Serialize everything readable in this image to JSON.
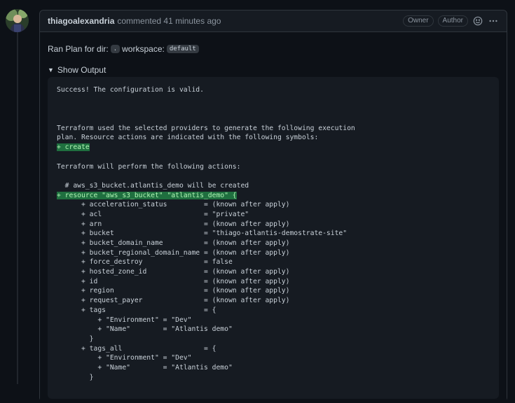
{
  "comment": {
    "author": "thiagoalexandria",
    "action": "commented 41 minutes ago",
    "badges": [
      "Owner",
      "Author"
    ],
    "emoji_icon": "smiley-icon",
    "menu_icon": "kebab-horizontal-icon",
    "ran_plan_prefix": "Ran Plan for dir:",
    "dir_value": ".",
    "workspace_label": "workspace:",
    "workspace_value": "default",
    "details_label": "Show Output"
  },
  "output_lines": [
    {
      "text": "Success! The configuration is valid.",
      "added": false
    },
    {
      "text": "",
      "added": false
    },
    {
      "text": "",
      "added": false
    },
    {
      "text": "",
      "added": false
    },
    {
      "text": "Terraform used the selected providers to generate the following execution",
      "added": false
    },
    {
      "text": "plan. Resource actions are indicated with the following symbols:",
      "added": false
    },
    {
      "text": "+ create",
      "added": true
    },
    {
      "text": "",
      "added": false
    },
    {
      "text": "Terraform will perform the following actions:",
      "added": false
    },
    {
      "text": "",
      "added": false
    },
    {
      "text": "  # aws_s3_bucket.atlantis_demo will be created",
      "added": false
    },
    {
      "text": "+ resource \"aws_s3_bucket\" \"atlantis_demo\" {",
      "added": true
    },
    {
      "text": "      + acceleration_status         = (known after apply)",
      "added": false
    },
    {
      "text": "      + acl                         = \"private\"",
      "added": false
    },
    {
      "text": "      + arn                         = (known after apply)",
      "added": false
    },
    {
      "text": "      + bucket                      = \"thiago-atlantis-demostrate-site\"",
      "added": false
    },
    {
      "text": "      + bucket_domain_name          = (known after apply)",
      "added": false
    },
    {
      "text": "      + bucket_regional_domain_name = (known after apply)",
      "added": false
    },
    {
      "text": "      + force_destroy               = false",
      "added": false
    },
    {
      "text": "      + hosted_zone_id              = (known after apply)",
      "added": false
    },
    {
      "text": "      + id                          = (known after apply)",
      "added": false
    },
    {
      "text": "      + region                      = (known after apply)",
      "added": false
    },
    {
      "text": "      + request_payer               = (known after apply)",
      "added": false
    },
    {
      "text": "      + tags                        = {",
      "added": false
    },
    {
      "text": "          + \"Environment\" = \"Dev\"",
      "added": false
    },
    {
      "text": "          + \"Name\"        = \"Atlantis demo\"",
      "added": false
    },
    {
      "text": "        }",
      "added": false
    },
    {
      "text": "      + tags_all                    = {",
      "added": false
    },
    {
      "text": "          + \"Environment\" = \"Dev\"",
      "added": false
    },
    {
      "text": "          + \"Name\"        = \"Atlantis demo\"",
      "added": false
    },
    {
      "text": "        }",
      "added": false
    }
  ],
  "colors": {
    "background": "#0d1117",
    "surface": "#161b22",
    "border": "#30363d",
    "added_bg": "#1f6f3f",
    "added_fg": "#aff5b4"
  }
}
